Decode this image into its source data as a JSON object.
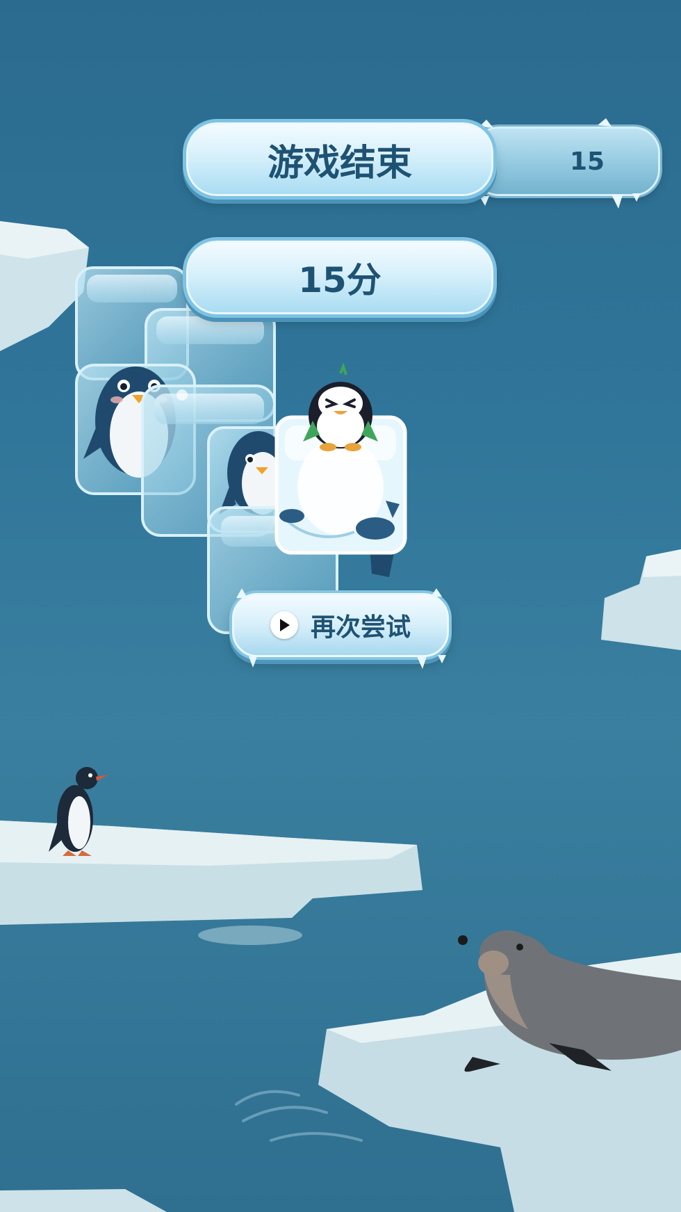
{
  "header": {
    "title": "游戏结束",
    "score_tag": "15"
  },
  "result": {
    "score_text": "15分"
  },
  "actions": {
    "retry_label": "再次尝试",
    "retry_icon": "play-icon"
  },
  "colors": {
    "sea": "#30769a",
    "ice": "#e8f6fc",
    "text": "#1e5273"
  }
}
